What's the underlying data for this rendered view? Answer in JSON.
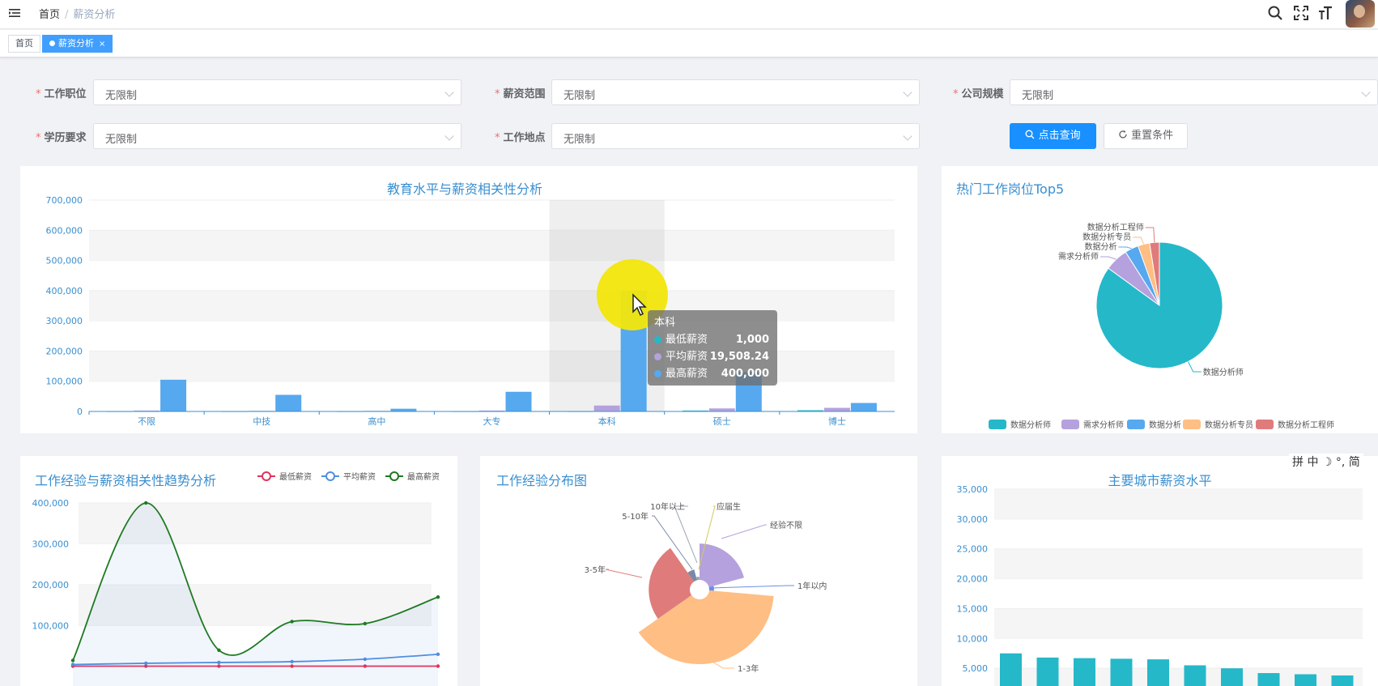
{
  "header": {
    "breadcrumb": [
      "首页",
      "薪资分析"
    ]
  },
  "tags": [
    {
      "label": "首页"
    },
    {
      "label": "薪资分析"
    }
  ],
  "filters": {
    "job_position": {
      "label": "工作职位",
      "value": "无限制"
    },
    "salary_range": {
      "label": "薪资范围",
      "value": "无限制"
    },
    "company_size": {
      "label": "公司规模",
      "value": "无限制"
    },
    "education": {
      "label": "学历要求",
      "value": "无限制"
    },
    "location": {
      "label": "工作地点",
      "value": "无限制"
    },
    "query_button": "点击查询",
    "reset_button": "重置条件"
  },
  "colors": {
    "cyan": "#25b8c9",
    "purple": "#b5a1dd",
    "blue": "#56a8ef",
    "orange": "#ffbe84",
    "red": "#e07b7b",
    "green": "#1f7a21",
    "accent": "#1890ff"
  },
  "chart_data": [
    {
      "id": "edu",
      "type": "bar",
      "title": "教育水平与薪资相关性分析",
      "categories": [
        "不限",
        "中技",
        "高中",
        "大专",
        "本科",
        "硕士",
        "博士"
      ],
      "ylim": [
        0,
        700000
      ],
      "yticks": [
        "0",
        "100,000",
        "200,000",
        "300,000",
        "400,000",
        "500,000",
        "600,000",
        "700,000"
      ],
      "series": [
        {
          "name": "最低薪资",
          "values": [
            1000,
            1000,
            1000,
            1000,
            1000,
            3000,
            4000
          ]
        },
        {
          "name": "平均薪资",
          "values": [
            3000,
            2000,
            2000,
            3000,
            19508.24,
            10000,
            12000
          ]
        },
        {
          "name": "最高薪资",
          "values": [
            105000,
            55000,
            9000,
            65000,
            400000,
            130000,
            28000
          ]
        }
      ],
      "tooltip": {
        "title": "本科",
        "rows": [
          {
            "name": "最低薪资",
            "value": "1,000"
          },
          {
            "name": "平均薪资",
            "value": "19,508.24"
          },
          {
            "name": "最高薪资",
            "value": "400,000"
          }
        ]
      }
    },
    {
      "id": "top5",
      "type": "pie",
      "title": "热门工作岗位Top5",
      "slices": [
        {
          "name": "数据分析师",
          "value": 85
        },
        {
          "name": "需求分析师",
          "value": 6
        },
        {
          "name": "数据分析",
          "value": 3.5
        },
        {
          "name": "数据分析专员",
          "value": 3
        },
        {
          "name": "数据分析工程师",
          "value": 2.5
        }
      ]
    },
    {
      "id": "exp_trend",
      "type": "line",
      "title": "工作经验与薪资相关性趋势分析",
      "legend": [
        "最低薪资",
        "平均薪资",
        "最高薪资"
      ],
      "yticks": [
        "100,000",
        "200,000",
        "300,000",
        "400,000"
      ],
      "ylim": [
        0,
        450000
      ],
      "series": [
        {
          "name": "最低薪资",
          "values": [
            1000,
            1000,
            1000,
            1000,
            1000,
            1000
          ]
        },
        {
          "name": "平均薪资",
          "values": [
            5000,
            8000,
            10000,
            12000,
            18000,
            30000
          ]
        },
        {
          "name": "最高薪资",
          "values": [
            15000,
            400000,
            40000,
            110000,
            105000,
            170000
          ]
        }
      ]
    },
    {
      "id": "exp_dist",
      "type": "pie",
      "title": "工作经验分布图",
      "slices": [
        {
          "name": "经验不限",
          "value": 22
        },
        {
          "name": "1年以内",
          "value": 2
        },
        {
          "name": "1-3年",
          "value": 40
        },
        {
          "name": "3-5年",
          "value": 25
        },
        {
          "name": "5-10年",
          "value": 6
        },
        {
          "name": "10年以上",
          "value": 1
        },
        {
          "name": "应届生",
          "value": 0.5
        }
      ]
    },
    {
      "id": "city",
      "type": "bar",
      "title": "主要城市薪资水平",
      "yticks": [
        "5,000",
        "10,000",
        "15,000",
        "20,000",
        "25,000",
        "30,000",
        "35,000"
      ],
      "ylim": [
        0,
        35000
      ],
      "values": [
        7500,
        6800,
        6700,
        6600,
        6500,
        5500,
        5000,
        4200,
        4000,
        3800
      ]
    }
  ],
  "ime": "拼 中 ☽ °, 简"
}
